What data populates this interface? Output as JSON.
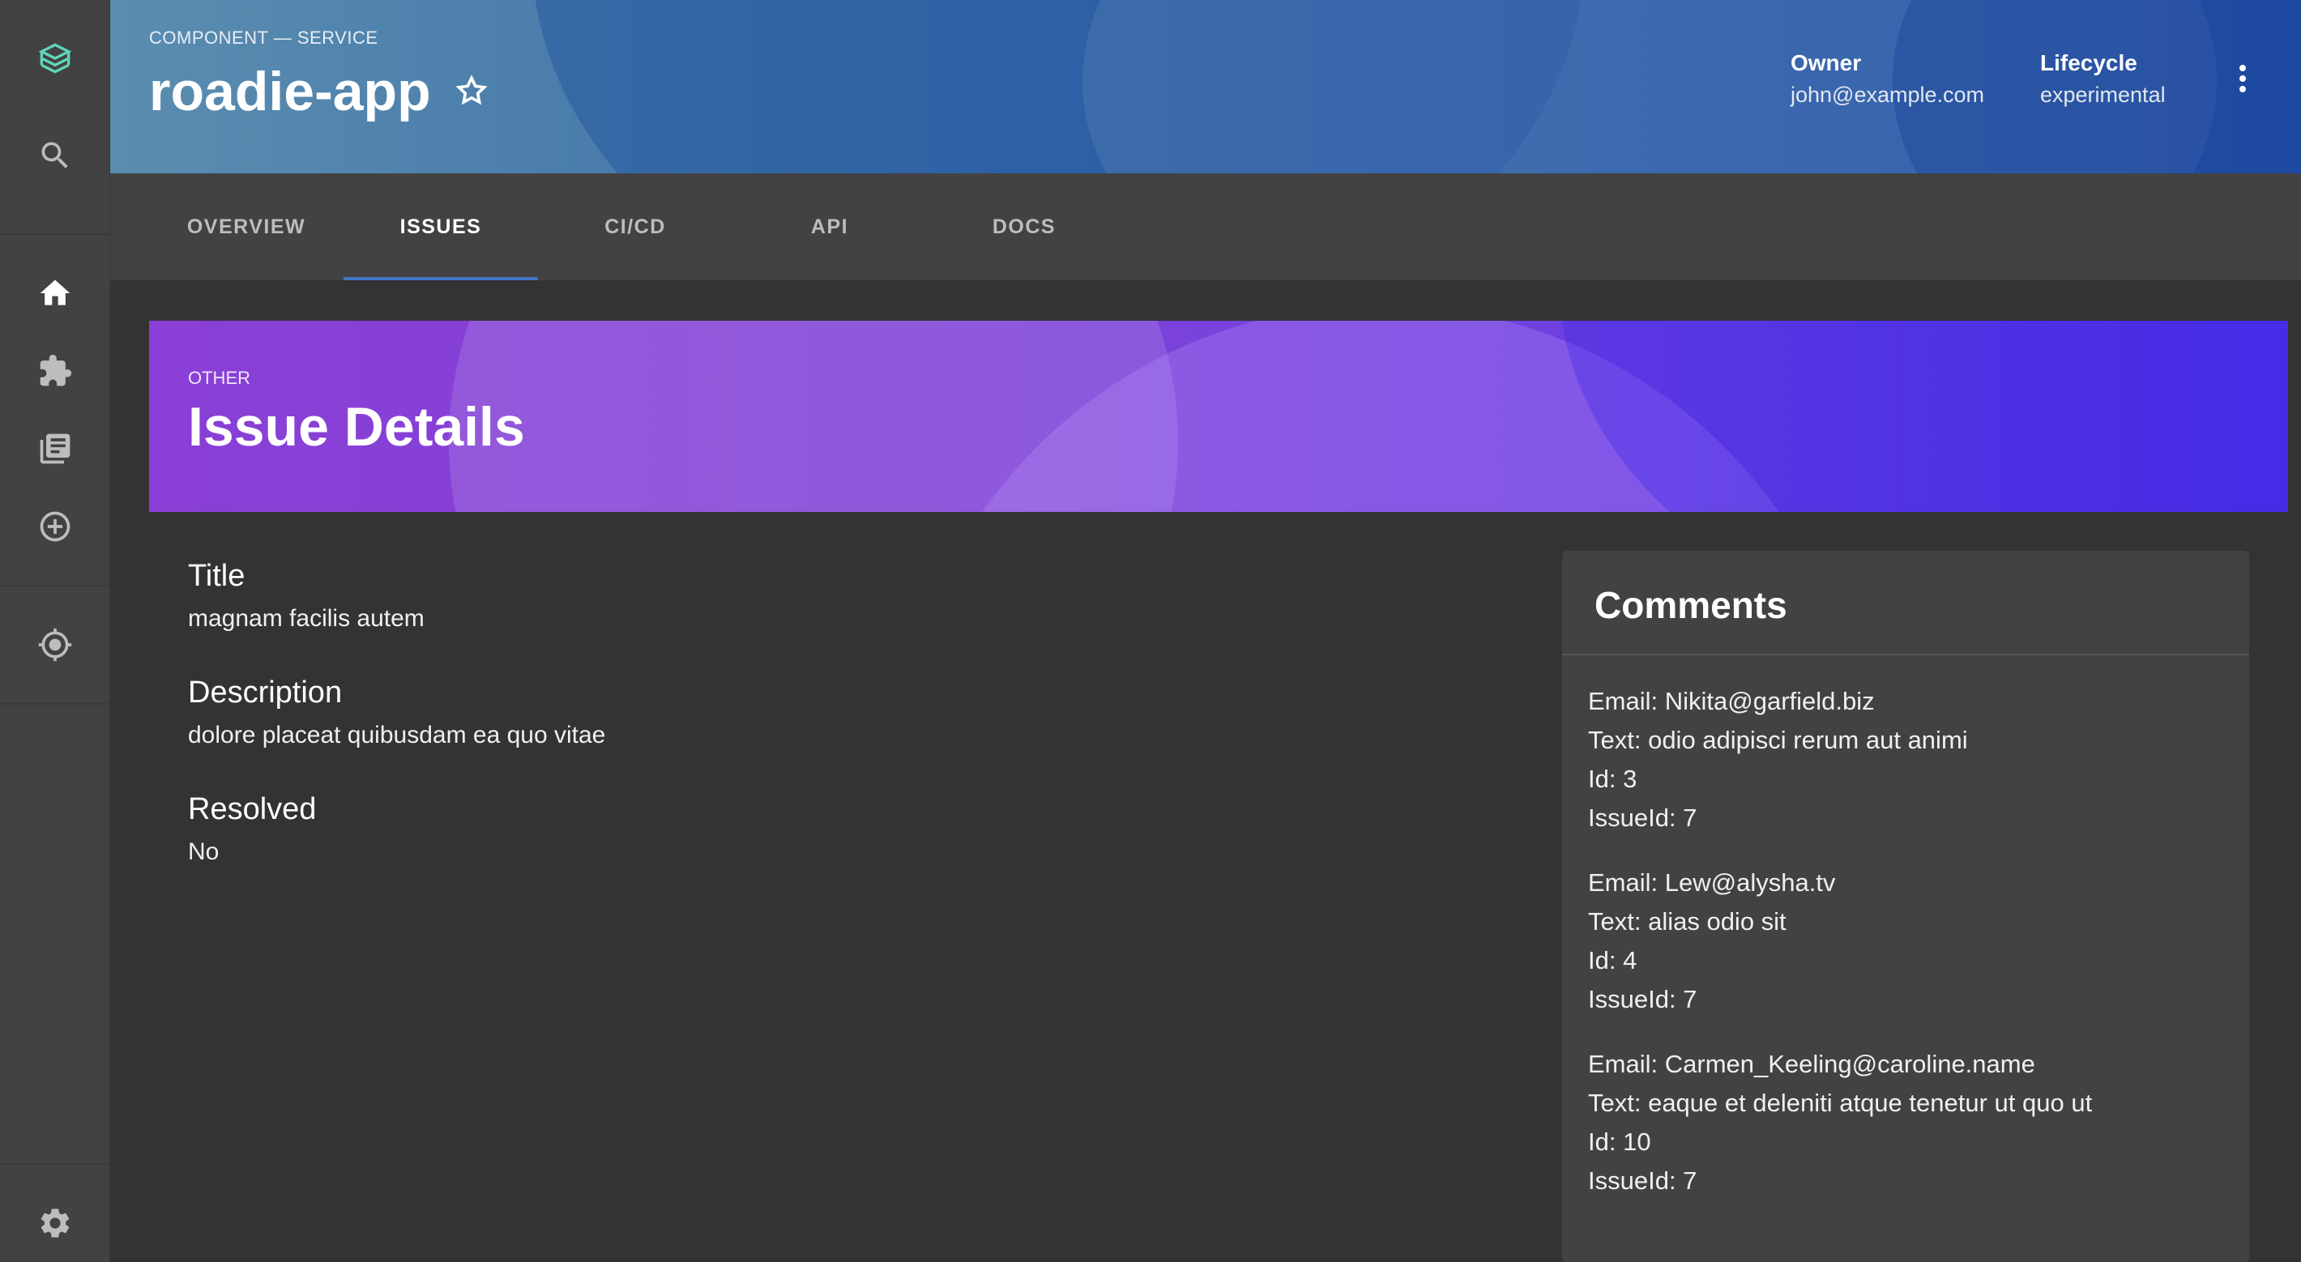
{
  "sidebar": {
    "icons": [
      "logo-icon",
      "search-icon",
      "home-icon",
      "extension-icon",
      "library-books-icon",
      "add-circle-icon",
      "target-icon",
      "settings-icon"
    ]
  },
  "header": {
    "kicker": "COMPONENT — SERVICE",
    "title": "roadie-app",
    "owner_label": "Owner",
    "owner_value": "john@example.com",
    "lifecycle_label": "Lifecycle",
    "lifecycle_value": "experimental"
  },
  "tabs": [
    {
      "label": "OVERVIEW"
    },
    {
      "label": "ISSUES",
      "active": true
    },
    {
      "label": "CI/CD"
    },
    {
      "label": "API"
    },
    {
      "label": "DOCS"
    }
  ],
  "banner": {
    "kicker": "OTHER",
    "title": "Issue Details"
  },
  "issue": {
    "title_label": "Title",
    "title_value": "magnam facilis autem",
    "description_label": "Description",
    "description_value": "dolore placeat quibusdam ea quo vitae",
    "resolved_label": "Resolved",
    "resolved_value": "No"
  },
  "comments": {
    "title": "Comments",
    "items": [
      {
        "email": "Email: Nikita@garfield.biz",
        "text": "Text: odio adipisci rerum aut animi",
        "id": "Id: 3",
        "issueId": "IssueId: 7"
      },
      {
        "email": "Email: Lew@alysha.tv",
        "text": "Text: alias odio sit",
        "id": "Id: 4",
        "issueId": "IssueId: 7"
      },
      {
        "email": "Email: Carmen_Keeling@caroline.name",
        "text": "Text: eaque et deleniti atque tenetur ut quo ut",
        "id": "Id: 10",
        "issueId": "IssueId: 7"
      }
    ]
  },
  "colors": {
    "accent": "#3f73c4",
    "banner_start": "#8a3fd6",
    "banner_end": "#4a2ee6",
    "header_start": "#5b8db0",
    "header_end": "#2350a6"
  }
}
